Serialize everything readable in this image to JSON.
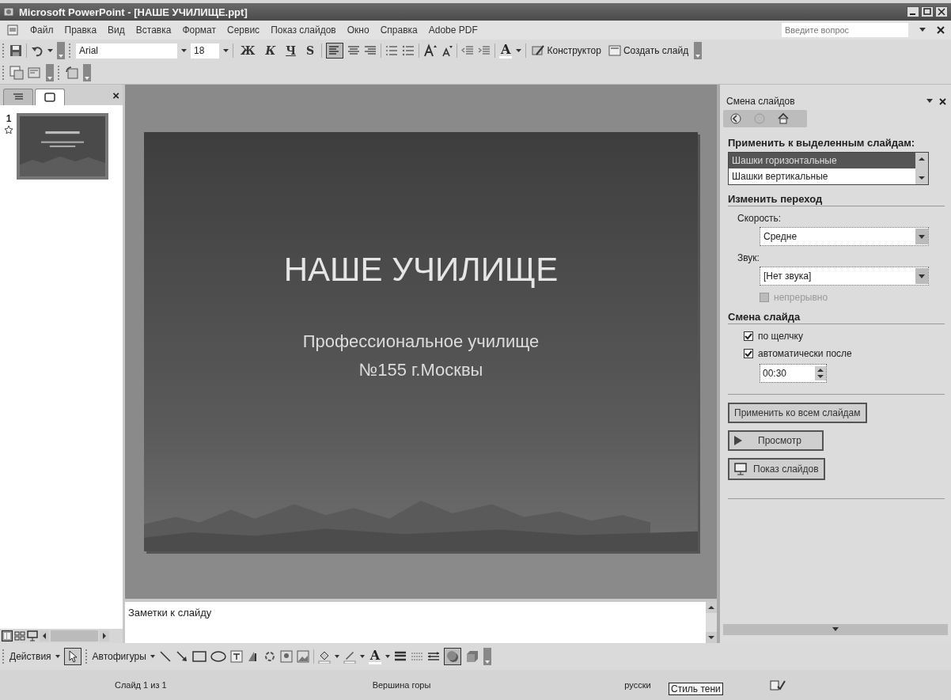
{
  "window": {
    "title": "Microsoft PowerPoint - [НАШЕ УЧИЛИЩЕ.ppt]"
  },
  "menu": [
    "Файл",
    "Правка",
    "Вид",
    "Вставка",
    "Формат",
    "Сервис",
    "Показ слайдов",
    "Окно",
    "Справка",
    "Adobe PDF"
  ],
  "help_box": {
    "placeholder": "Введите вопрос"
  },
  "formatting_toolbar": {
    "font": "Arial",
    "size": "18",
    "bold": "Ж",
    "italic": "К",
    "underline": "Ч",
    "shadow": "S",
    "font_color": "A",
    "buttons": [
      "Конструктор",
      "Создать слайд"
    ]
  },
  "slides_panel": {
    "tabs": [
      {
        "kind": "outline",
        "selected": false
      },
      {
        "kind": "slides",
        "selected": true
      }
    ],
    "close": "×",
    "thumbnails": [
      {
        "number": "1",
        "selected": true
      }
    ]
  },
  "slide": {
    "title": "НАШЕ УЧИЛИЩЕ",
    "subtitle_lines": [
      "Профессиональное училище",
      "№155 г.Москвы"
    ]
  },
  "notes": {
    "text": "Заметки к слайду"
  },
  "task_pane": {
    "title": "Смена слайдов",
    "apply_heading": "Применить к выделенным слайдам:",
    "transitions": [
      {
        "label": "Шашки горизонтальные",
        "selected": true
      },
      {
        "label": "Шашки вертикальные",
        "selected": false
      }
    ],
    "modify_heading": "Изменить переход",
    "speed_label": "Скорость:",
    "speed": "Средне",
    "sound_label": "Звук:",
    "sound": "[Нет звука]",
    "loop": {
      "label": "непрерывно",
      "checked": false,
      "disabled": true
    },
    "advance_heading": "Смена слайда",
    "advance_options": [
      {
        "label": "по щелчку",
        "checked": true
      },
      {
        "label": "автоматически после",
        "checked": true
      }
    ],
    "advance_time": "00:30",
    "buttons": [
      {
        "kind": "apply_all",
        "label": "Применить ко всем слайдам"
      },
      {
        "kind": "play",
        "label": "Просмотр"
      },
      {
        "kind": "slideshow",
        "label": "Показ слайдов"
      }
    ]
  },
  "drawing_toolbar": {
    "actions": "Действия",
    "autoshapes": "Автофигуры",
    "font_color": "A"
  },
  "status_bar": {
    "slide": "Слайд 1 из 1",
    "design": "Вершина горы",
    "language": "русски"
  },
  "tooltip": {
    "text": "Стиль тени"
  }
}
